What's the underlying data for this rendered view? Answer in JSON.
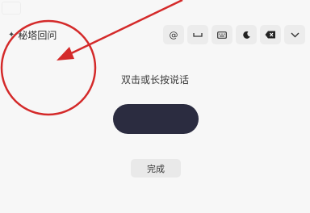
{
  "app": {
    "title": "秘塔回问",
    "spark_icon": "sparkle-icon"
  },
  "toolbar": {
    "items": [
      {
        "name": "at-symbol-button",
        "icon": "at-icon",
        "label": "@"
      },
      {
        "name": "space-key-button",
        "icon": "space-icon"
      },
      {
        "name": "keyboard-button",
        "icon": "keyboard-icon"
      },
      {
        "name": "dark-mode-button",
        "icon": "moon-icon"
      },
      {
        "name": "backspace-button",
        "icon": "backspace-icon"
      },
      {
        "name": "collapse-button",
        "icon": "chevron-down-icon"
      }
    ]
  },
  "main": {
    "hint": "双击或长按说话",
    "done_label": "完成"
  },
  "annotation": {
    "color": "#d42a2a"
  }
}
